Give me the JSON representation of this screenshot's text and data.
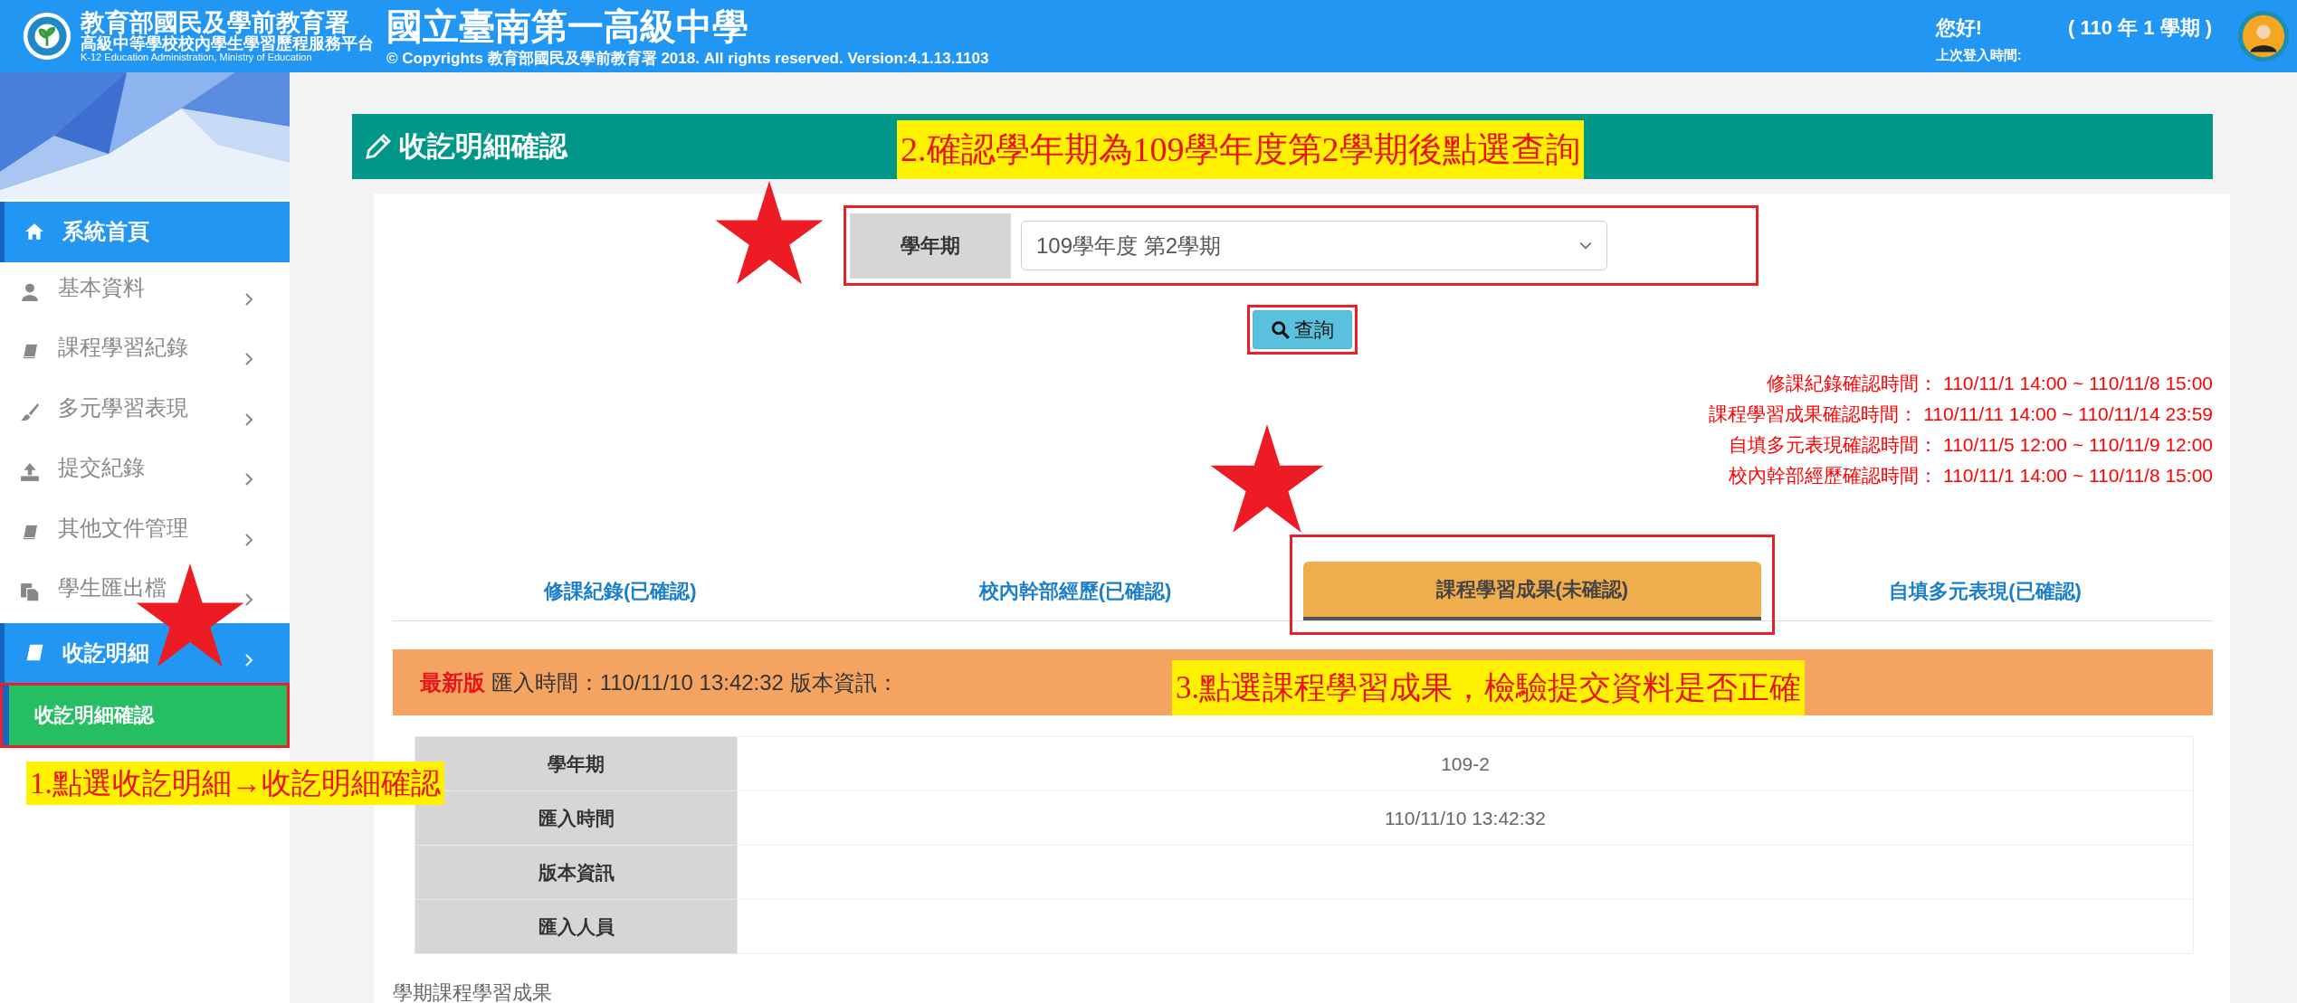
{
  "header": {
    "org_name": "教育部國民及學前教育署",
    "platform_name": "高級中等學校校內學生學習歷程服務平台",
    "org_english": "K-12 Education Administration, Ministry of Education",
    "school_name": "國立臺南第一高級中學",
    "copyright": "© Copyrights 教育部國民及學前教育署 2018. All rights reserved. Version:4.1.13.1103",
    "greeting": "您好!",
    "term": "( 110 年 1 學期 )",
    "last_login_label": "上次登入時間:"
  },
  "sidebar": {
    "items": [
      {
        "label": "系統首頁",
        "highlighted": true,
        "expandable": false
      },
      {
        "label": "基本資料",
        "highlighted": false,
        "expandable": true
      },
      {
        "label": "課程學習紀錄",
        "highlighted": false,
        "expandable": true
      },
      {
        "label": "多元學習表現",
        "highlighted": false,
        "expandable": true
      },
      {
        "label": "提交紀錄",
        "highlighted": false,
        "expandable": true
      },
      {
        "label": "其他文件管理",
        "highlighted": false,
        "expandable": true
      },
      {
        "label": "學生匯出檔",
        "highlighted": false,
        "expandable": true
      },
      {
        "label": "收訖明細",
        "highlighted": true,
        "expandable": true,
        "children": [
          {
            "label": "收訖明細確認",
            "selected": true
          }
        ]
      }
    ]
  },
  "page": {
    "title": "收訖明細確認",
    "filter": {
      "label": "學年期",
      "value": "109學年度 第2學期"
    },
    "query_button": "查詢",
    "schedule": [
      "修課紀錄確認時間： 110/11/1 14:00 ~ 110/11/8 15:00",
      "課程學習成果確認時間： 110/11/11 14:00 ~ 110/11/14 23:59",
      "自填多元表現確認時間： 110/11/5 12:00 ~ 110/11/9 12:00",
      "校內幹部經歷確認時間： 110/11/1 14:00 ~ 110/11/8 15:00"
    ],
    "tabs": [
      {
        "label": "修課紀錄(已確認)",
        "selected": false
      },
      {
        "label": "校內幹部經歷(已確認)",
        "selected": false
      },
      {
        "label": "課程學習成果(未確認)",
        "selected": true
      },
      {
        "label": "自填多元表現(已確認)",
        "selected": false
      }
    ],
    "version_bar": {
      "badge": "最新版",
      "text": "匯入時間：110/11/10 13:42:32 版本資訊："
    },
    "info_table": [
      {
        "label": "學年期",
        "value": "109-2"
      },
      {
        "label": "匯入時間",
        "value": "110/11/10 13:42:32"
      },
      {
        "label": "版本資訊"
      },
      {
        "label": "匯入人員"
      }
    ],
    "section_title": "學期課程學習成果"
  },
  "annotations": {
    "sidebar_note": "1.點選收訖明細→收訖明細確認",
    "title_note": "2.確認學年期為109學年度第2學期後點選查詢",
    "tab_note": "3.點選課程學習成果，檢驗提交資料是否正確"
  }
}
